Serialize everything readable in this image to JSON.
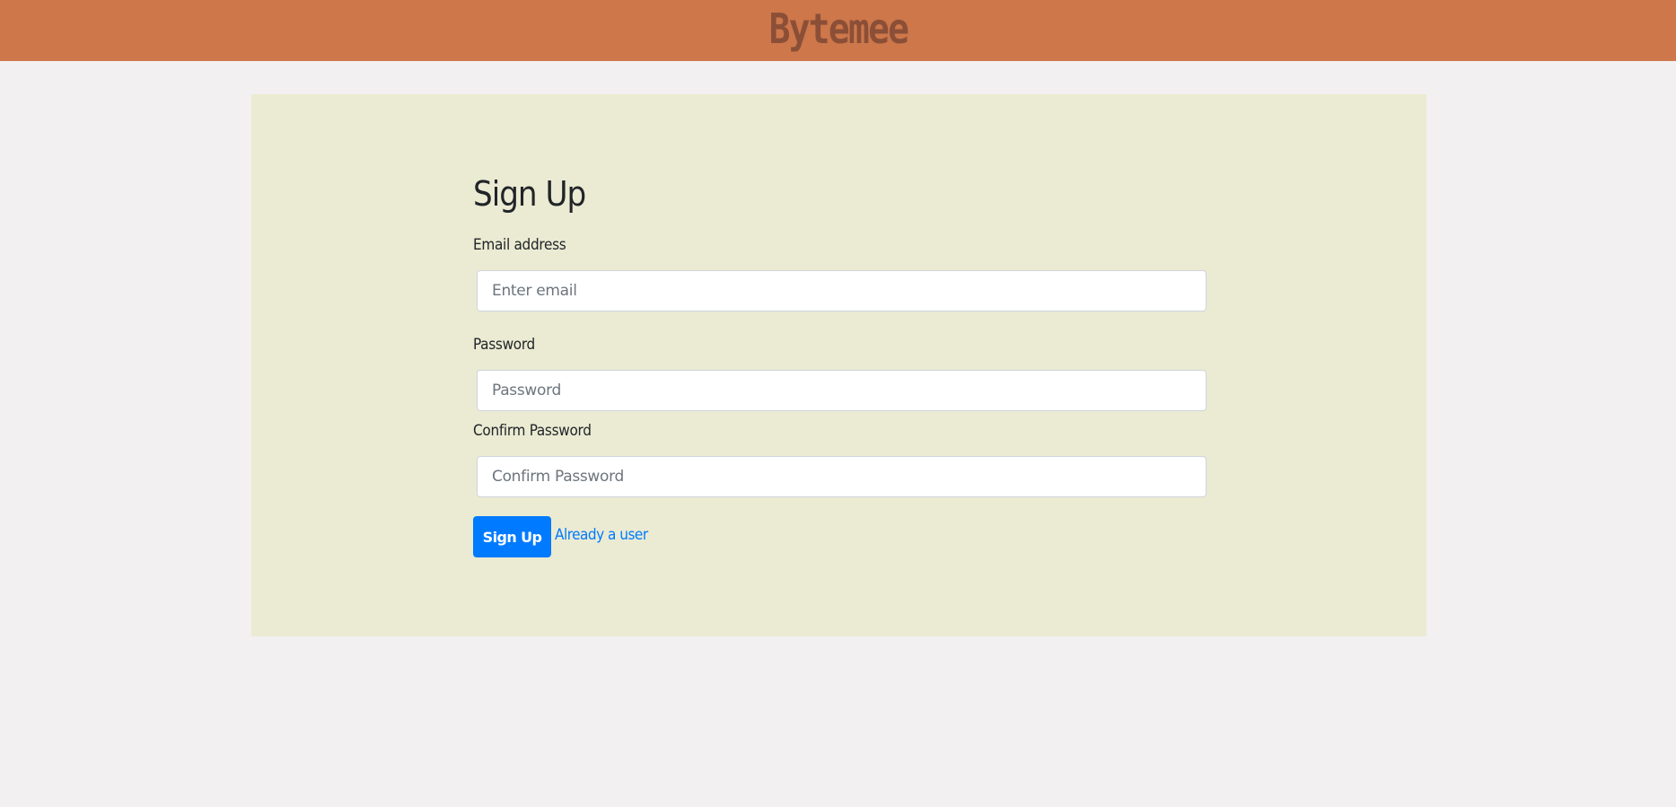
{
  "navbar": {
    "brand": "Bytemee"
  },
  "form": {
    "title": "Sign Up",
    "email": {
      "label": "Email address",
      "placeholder": "Enter email",
      "value": ""
    },
    "password": {
      "label": "Password",
      "placeholder": "Password",
      "value": ""
    },
    "confirm_password": {
      "label": "Confirm Password",
      "placeholder": "Confirm Password",
      "value": ""
    },
    "submit_label": "Sign Up",
    "login_link": "Already a user"
  },
  "colors": {
    "navbar_bg": "#cd774a",
    "brand_text": "#8b4f37",
    "page_bg": "#f2f0f0",
    "card_bg": "#ebebd3",
    "primary": "#007bff"
  }
}
